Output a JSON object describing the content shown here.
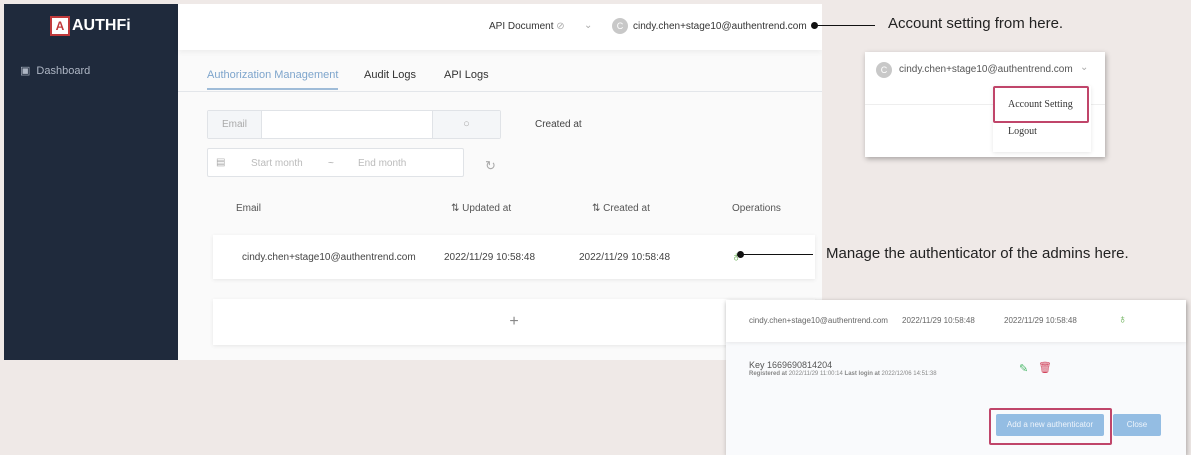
{
  "app": {
    "logo": "AUTHFi",
    "sidebar": [
      {
        "label": "Dashboard"
      }
    ]
  },
  "header": {
    "api_doc": "API Document",
    "user": "cindy.chen+stage10@authentrend.com",
    "avatar": "C"
  },
  "tabs": [
    "Authorization Management",
    "Audit Logs",
    "API Logs"
  ],
  "filters": {
    "email_label": "Email",
    "created_label": "Created at",
    "start_placeholder": "Start month",
    "end_placeholder": "End month",
    "sep": "~"
  },
  "table": {
    "headers": [
      "Email",
      "Updated at",
      "Created at",
      "Operations"
    ],
    "rows": [
      {
        "email": "cindy.chen+stage10@authentrend.com",
        "updated": "2022/11/29 10:58:48",
        "created": "2022/11/29 10:58:48"
      }
    ],
    "add": "+"
  },
  "dropdown": {
    "user": "cindy.chen+stage10@authentrend.com",
    "avatar": "C",
    "items": [
      "Account Setting",
      "Logout"
    ]
  },
  "detail": {
    "email": "cindy.chen+stage10@authentrend.com",
    "updated": "2022/11/29 10:58:48",
    "created": "2022/11/29 10:58:48",
    "key": "Key 1669690814204",
    "registered_label": "Registered at",
    "registered": "2022/11/29 11:00:14",
    "last_login_label": "Last login at",
    "last_login": "2022/12/06 14:51:38",
    "add_button": "Add a new authenticator",
    "close_button": "Close"
  },
  "annotations": {
    "account": "Account setting from here.",
    "manage": "Manage the authenticator of the admins here."
  }
}
